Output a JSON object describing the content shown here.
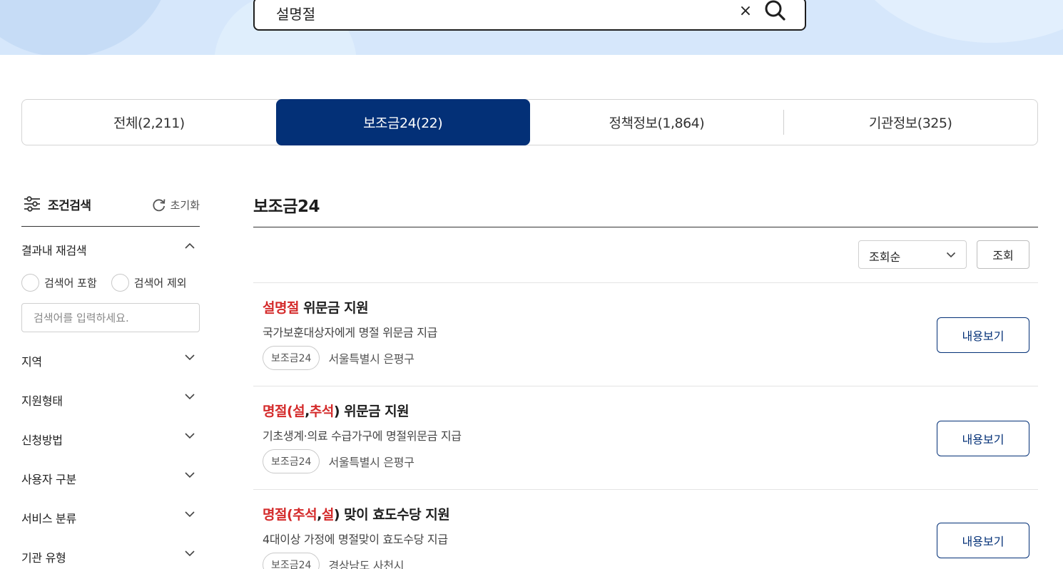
{
  "search": {
    "value": "설명절",
    "clear_label": "×"
  },
  "tabs": [
    {
      "label": "전체(2,211)",
      "active": false
    },
    {
      "label": "보조금24(22)",
      "active": true
    },
    {
      "label": "정책정보(1,864)",
      "active": false
    },
    {
      "label": "기관정보(325)",
      "active": false
    }
  ],
  "sidebar": {
    "title": "조건검색",
    "reset_label": "초기화",
    "refine": {
      "label": "결과내 재검색",
      "include_label": "검색어 포함",
      "exclude_label": "검색어 제외",
      "placeholder": "검색어를 입력하세요."
    },
    "filters": [
      "지역",
      "지원형태",
      "신청방법",
      "사용자 구분",
      "서비스 분류",
      "기관 유형"
    ]
  },
  "main": {
    "section_title": "보조금24",
    "sort_value": "조회순",
    "query_button": "조회",
    "results": [
      {
        "title_parts": [
          {
            "text": "설명절",
            "hl": true
          },
          {
            "text": " 위문금 지원",
            "hl": false
          }
        ],
        "description": "국가보훈대상자에게 명절 위문금 지급",
        "badge": "보조금24",
        "region": "서울특별시 은평구",
        "button": "내용보기"
      },
      {
        "title_parts": [
          {
            "text": "명절(",
            "hl": true
          },
          {
            "text": "설",
            "hl": true
          },
          {
            "text": ",",
            "hl": false
          },
          {
            "text": "추석",
            "hl": true
          },
          {
            "text": ") 위문금 지원",
            "hl": false
          }
        ],
        "description": "기초생계·의료 수급가구에 명절위문금 지급",
        "badge": "보조금24",
        "region": "서울특별시 은평구",
        "button": "내용보기"
      },
      {
        "title_parts": [
          {
            "text": "명절(",
            "hl": true
          },
          {
            "text": "추석",
            "hl": true
          },
          {
            "text": ",",
            "hl": false
          },
          {
            "text": "설",
            "hl": true
          },
          {
            "text": ") 맞이 효도수당 지원",
            "hl": false
          }
        ],
        "description": "4대이상 가정에 명절맞이 효도수당 지급",
        "badge": "보조금24",
        "region": "경상남도 사천시",
        "button": "내용보기"
      }
    ]
  },
  "colors": {
    "primary": "#033077",
    "highlight": "#d42b2b",
    "hero_bg": "#d6e7fb"
  }
}
